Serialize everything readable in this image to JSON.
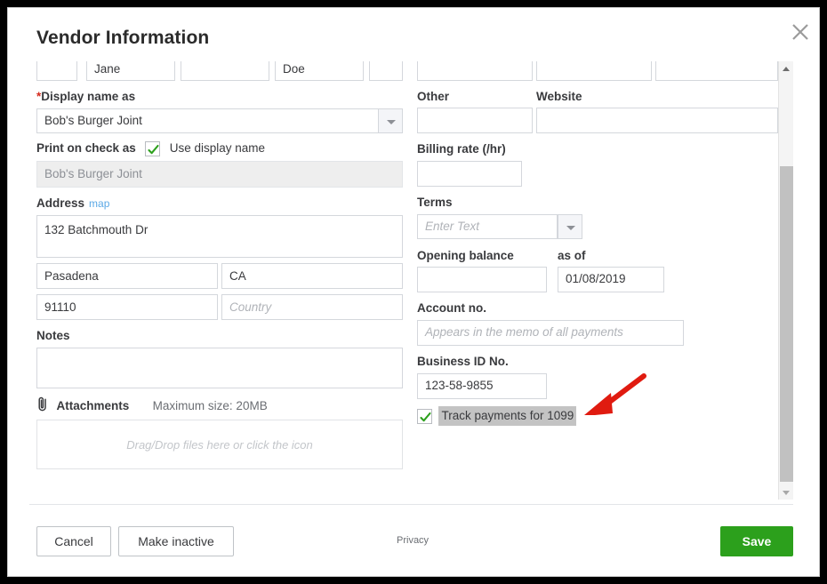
{
  "dialog": {
    "title": "Vendor Information",
    "close_icon": "close-icon"
  },
  "left_column": {
    "name_row": {
      "cut_off": true,
      "fields": [
        {
          "name": "title",
          "value": ""
        },
        {
          "name": "first-name",
          "value": "Jane"
        },
        {
          "name": "middle-name",
          "value": ""
        },
        {
          "name": "last-name",
          "value": "Doe"
        },
        {
          "name": "suffix",
          "value": ""
        }
      ]
    },
    "display_name": {
      "label": "Display name as",
      "required_marker": "*",
      "value": "Bob's Burger Joint",
      "dropdown_icon": "chevron-down-icon"
    },
    "print_on_check": {
      "label": "Print on check as",
      "checkbox_checked": true,
      "checkbox_label": "Use display name",
      "value": "Bob's Burger Joint",
      "disabled": true
    },
    "address": {
      "label": "Address",
      "map_link": "map",
      "street": "132 Batchmouth Dr",
      "city": "Pasadena",
      "state": "CA",
      "zip": "91110",
      "country": "",
      "country_placeholder": "Country"
    },
    "notes": {
      "label": "Notes",
      "value": ""
    },
    "attachments": {
      "icon": "paperclip-icon",
      "label": "Attachments",
      "max_size": "Maximum size: 20MB",
      "dropzone_text": "Drag/Drop files here or click the icon"
    }
  },
  "right_column": {
    "contact_row": {
      "cut_off": true,
      "fields": [
        {
          "name": "mobile",
          "value": ""
        },
        {
          "name": "fax",
          "value": ""
        },
        {
          "name": "email",
          "value": ""
        }
      ]
    },
    "other": {
      "label": "Other",
      "value": ""
    },
    "website": {
      "label": "Website",
      "value": ""
    },
    "billing_rate": {
      "label": "Billing rate (/hr)",
      "value": ""
    },
    "terms": {
      "label": "Terms",
      "value": "",
      "placeholder": "Enter Text",
      "dropdown_icon": "chevron-down-icon"
    },
    "opening_balance": {
      "label": "Opening balance",
      "value": ""
    },
    "as_of": {
      "label": "as of",
      "value": "01/08/2019"
    },
    "account_no": {
      "label": "Account no.",
      "value": "",
      "placeholder": "Appears in the memo of all payments"
    },
    "business_id": {
      "label": "Business ID No.",
      "value": "123-58-9855"
    },
    "track_1099": {
      "checked": true,
      "label": "Track payments for 1099",
      "highlighted": true
    }
  },
  "scrollbar": {
    "up_icon": "triangle-up-icon",
    "down_icon": "triangle-down-icon"
  },
  "footer": {
    "cancel_label": "Cancel",
    "make_inactive_label": "Make inactive",
    "privacy_label": "Privacy",
    "save_label": "Save"
  },
  "annotation": {
    "arrow_icon": "arrow-pointing-down-left-icon",
    "color": "#e01b10"
  },
  "colors": {
    "save_green": "#2ca01c",
    "check_green": "#2ca01c",
    "link_blue": "#5ba9e6",
    "required_red": "#d52b1e",
    "highlight_gray": "#c3c3c3"
  }
}
